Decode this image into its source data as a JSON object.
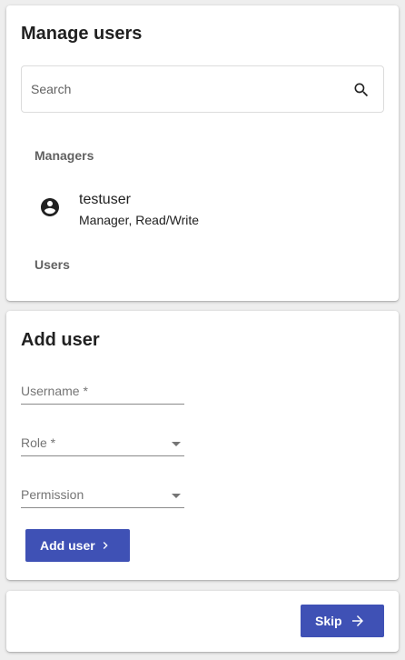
{
  "manage_users": {
    "title": "Manage users",
    "search": {
      "placeholder": "Search",
      "value": "",
      "icon": "search-icon"
    },
    "managers_header": "Managers",
    "managers": [
      {
        "name": "testuser",
        "role": "Manager, Read/Write",
        "icon": "account-circle-icon"
      }
    ],
    "users_header": "Users",
    "users": []
  },
  "add_user": {
    "title": "Add user",
    "username_label": "Username *",
    "role_label": "Role *",
    "permission_label": "Permission",
    "button_label": "Add user",
    "button_icon": "chevron-right-icon"
  },
  "actions": {
    "skip_label": "Skip",
    "skip_icon": "arrow-right-icon"
  },
  "colors": {
    "primary": "#3f51b5",
    "background": "#eeeeee",
    "card": "#ffffff",
    "subheader": "#616161"
  }
}
